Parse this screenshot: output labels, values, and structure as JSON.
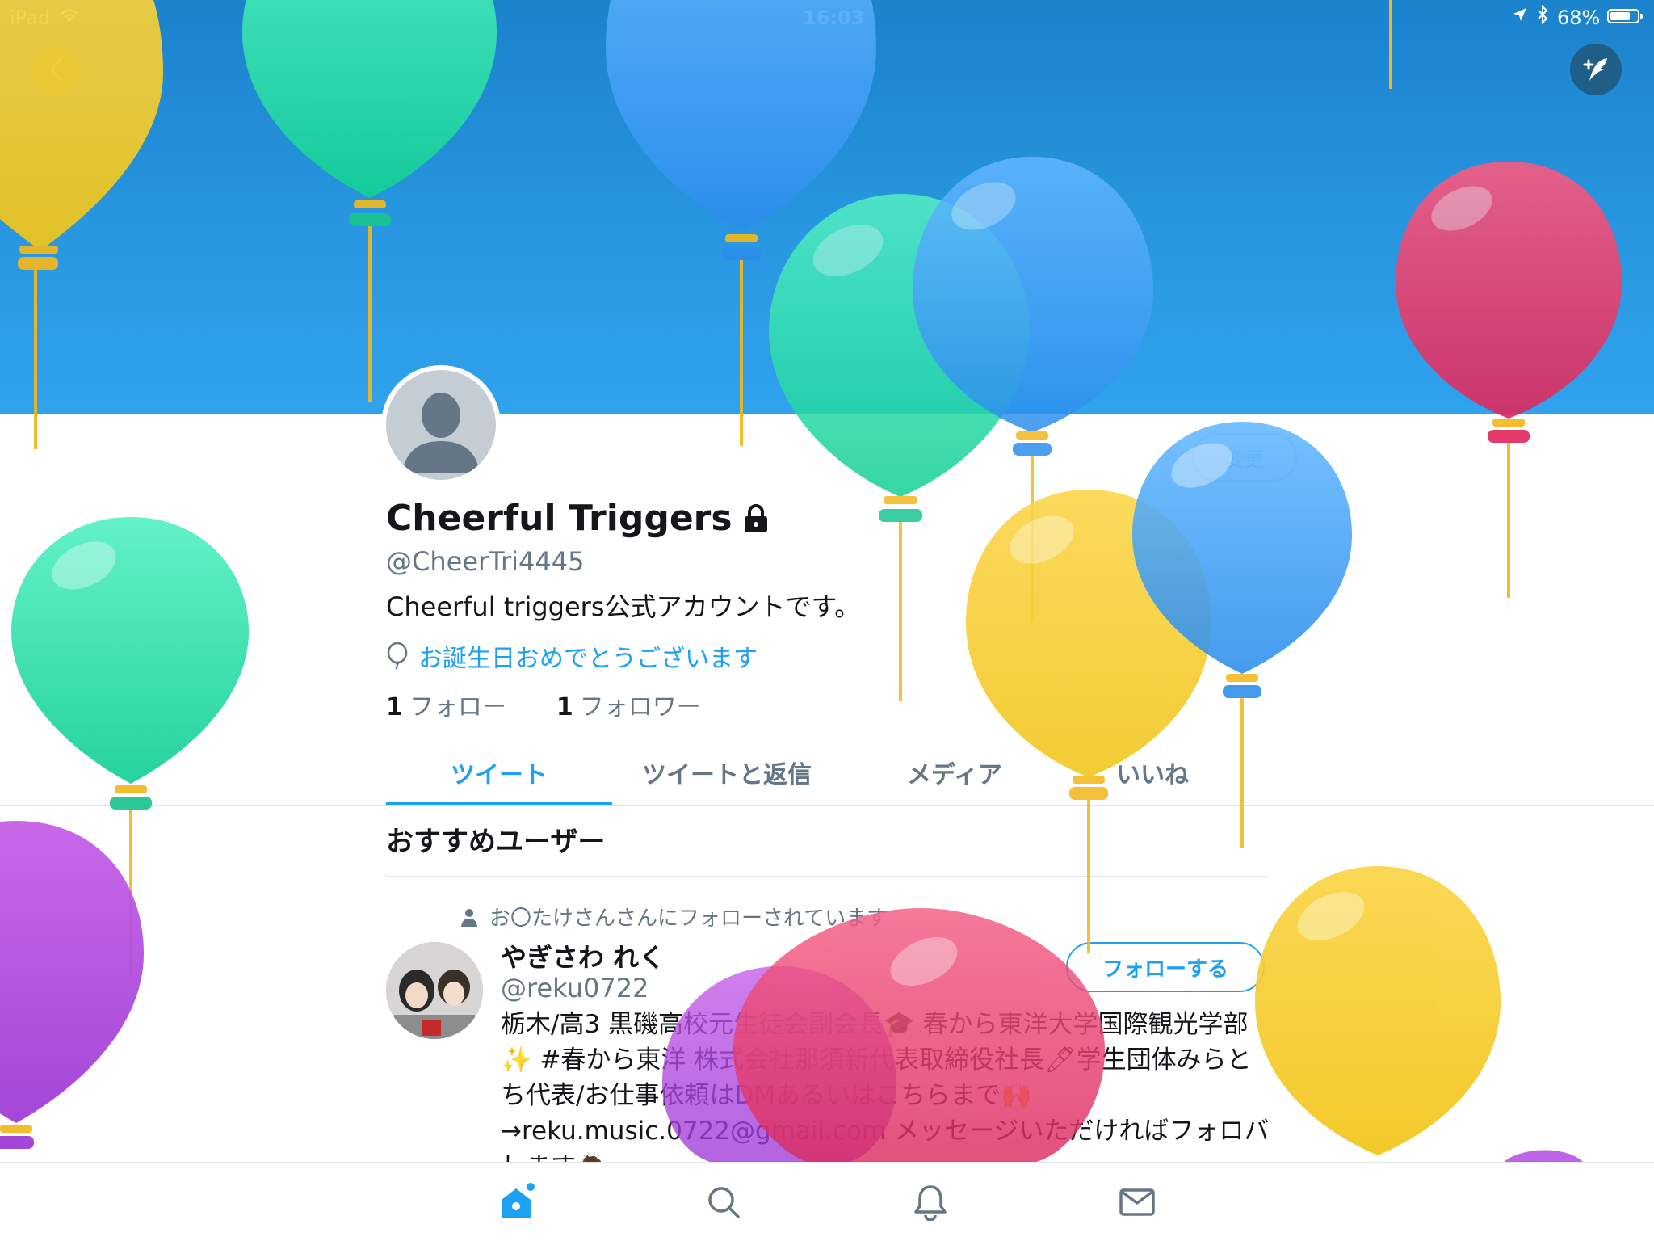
{
  "status_bar": {
    "device": "iPad",
    "time": "16:03",
    "battery": "68%"
  },
  "profile": {
    "name": "Cheerful Triggers",
    "handle": "@CheerTri4445",
    "bio": "Cheerful triggers公式アカウントです。",
    "birthday": "お誕生日おめでとうございます",
    "edit_label": "変更",
    "following_count": "1",
    "following_label": "フォロー",
    "followers_count": "1",
    "followers_label": "フォロワー"
  },
  "tabs": [
    {
      "label": "ツイート",
      "selected": true
    },
    {
      "label": "ツイートと返信",
      "selected": false
    },
    {
      "label": "メディア",
      "selected": false
    },
    {
      "label": "いいね",
      "selected": false
    }
  ],
  "suggestions": {
    "title": "おすすめユーザー",
    "followed_by": "お〇たけさんさんにフォローされています",
    "user": {
      "name": "やぎさわ れく",
      "handle": "@reku0722",
      "follow_label": "フォローする",
      "bio": "栃木/高3 黒磯高校元生徒会副会長🎓 春から東洋大学国際観光学部✨ #春から東洋 株式会社那須新代表取締役社長🖊学生団体みらとち代表/お仕事依頼はDMあるいはこちらまで🙌→reku.music.0722@gmail.com メッセージいただければフォロバします🙇"
    }
  },
  "icons": {
    "back": "chevron-left-icon",
    "compose": "compose-tweet-icon",
    "home": "home-icon",
    "search": "search-icon",
    "notifications": "bell-icon",
    "messages": "envelope-icon"
  },
  "colors": {
    "accent": "#1da1f2",
    "banner": "#1b82cc",
    "secondary_text": "#657786"
  }
}
